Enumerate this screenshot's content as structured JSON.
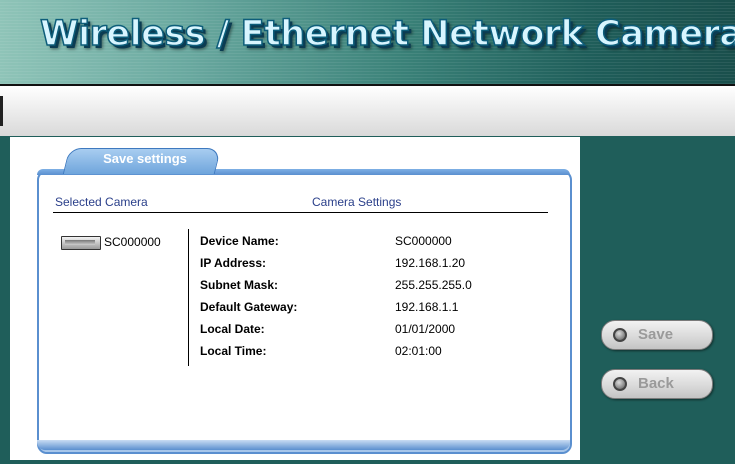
{
  "header": {
    "title": "Wireless / Ethernet Network Camera"
  },
  "tab": {
    "label": "Save settings"
  },
  "columns": {
    "selected_camera": "Selected Camera",
    "camera_settings": "Camera Settings"
  },
  "camera": {
    "name": "SC000000"
  },
  "settings": [
    {
      "label": "Device Name:",
      "value": "SC000000"
    },
    {
      "label": "IP Address:",
      "value": "192.168.1.20"
    },
    {
      "label": "Subnet Mask:",
      "value": "255.255.255.0"
    },
    {
      "label": "Default Gateway:",
      "value": "192.168.1.1"
    },
    {
      "label": "Local Date:",
      "value": "01/01/2000"
    },
    {
      "label": "Local Time:",
      "value": "02:01:00"
    }
  ],
  "buttons": {
    "save": "Save",
    "back": "Back"
  },
  "colors": {
    "background": "#1f5e5a",
    "accent": "#5a8fcf",
    "label_blue": "#2a3f8a"
  }
}
